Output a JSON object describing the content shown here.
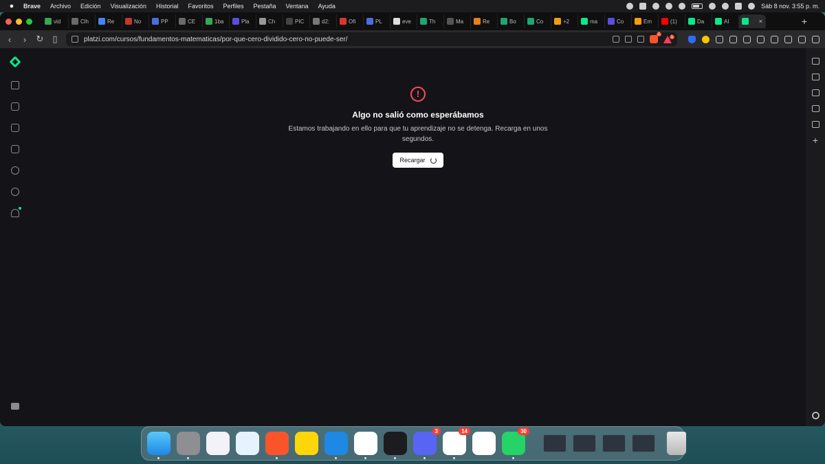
{
  "menubar": {
    "app": "Brave",
    "items": [
      "Archivo",
      "Edición",
      "Visualización",
      "Historial",
      "Favoritos",
      "Perfiles",
      "Pestaña",
      "Ventana",
      "Ayuda"
    ],
    "clock": "Sáb 8 nov.  3:55 p. m."
  },
  "tabs": [
    {
      "label": "vid",
      "color": "#34a853"
    },
    {
      "label": "Clh",
      "color": "#6a6a6a"
    },
    {
      "label": "Re",
      "color": "#4285f4"
    },
    {
      "label": "No",
      "color": "#c0392b"
    },
    {
      "label": "PP",
      "color": "#4a6ee0"
    },
    {
      "label": "CE",
      "color": "#6a6a6a"
    },
    {
      "label": "1ba",
      "color": "#34a853"
    },
    {
      "label": "Pla",
      "color": "#5b4de0"
    },
    {
      "label": "Ch",
      "color": "#999999"
    },
    {
      "label": "PIC",
      "color": "#444444"
    },
    {
      "label": "d2:",
      "color": "#777777"
    },
    {
      "label": "Ofi",
      "color": "#d33"
    },
    {
      "label": "PL",
      "color": "#4a6ee0"
    },
    {
      "label": "eve",
      "color": "#dddddd"
    },
    {
      "label": "Th",
      "color": "#1ea672"
    },
    {
      "label": "Ma",
      "color": "#555555"
    },
    {
      "label": "Re",
      "color": "#e67e22"
    },
    {
      "label": "Bo",
      "color": "#1ea672"
    },
    {
      "label": "Co",
      "color": "#1ea672"
    },
    {
      "label": "+2",
      "color": "#f39c12"
    },
    {
      "label": "ma",
      "color": "#0ae98a"
    },
    {
      "label": "Co",
      "color": "#5b4de0"
    },
    {
      "label": "Em",
      "color": "#f39c12"
    },
    {
      "label": "(1)",
      "color": "#ff0000"
    },
    {
      "label": "Da",
      "color": "#0ae98a"
    },
    {
      "label": "AI",
      "color": "#0ae98a"
    },
    {
      "label": "",
      "color": "#0ae98a",
      "active": true
    }
  ],
  "toolbar": {
    "url": "platzi.com/cursos/fundamentos-matematicas/por-que-cero-dividido-cero-no-puede-ser/",
    "shield_count": "2",
    "alert_count": "1"
  },
  "error": {
    "icon": "!",
    "title": "Algo no salió como esperábamos",
    "message": "Estamos trabajando en ello para que tu aprendizaje no se detenga. Recarga en unos segundos.",
    "reload_label": "Recargar"
  },
  "dock": {
    "badges": {
      "discord": "3",
      "notion": "14",
      "whatsapp": "30"
    }
  }
}
